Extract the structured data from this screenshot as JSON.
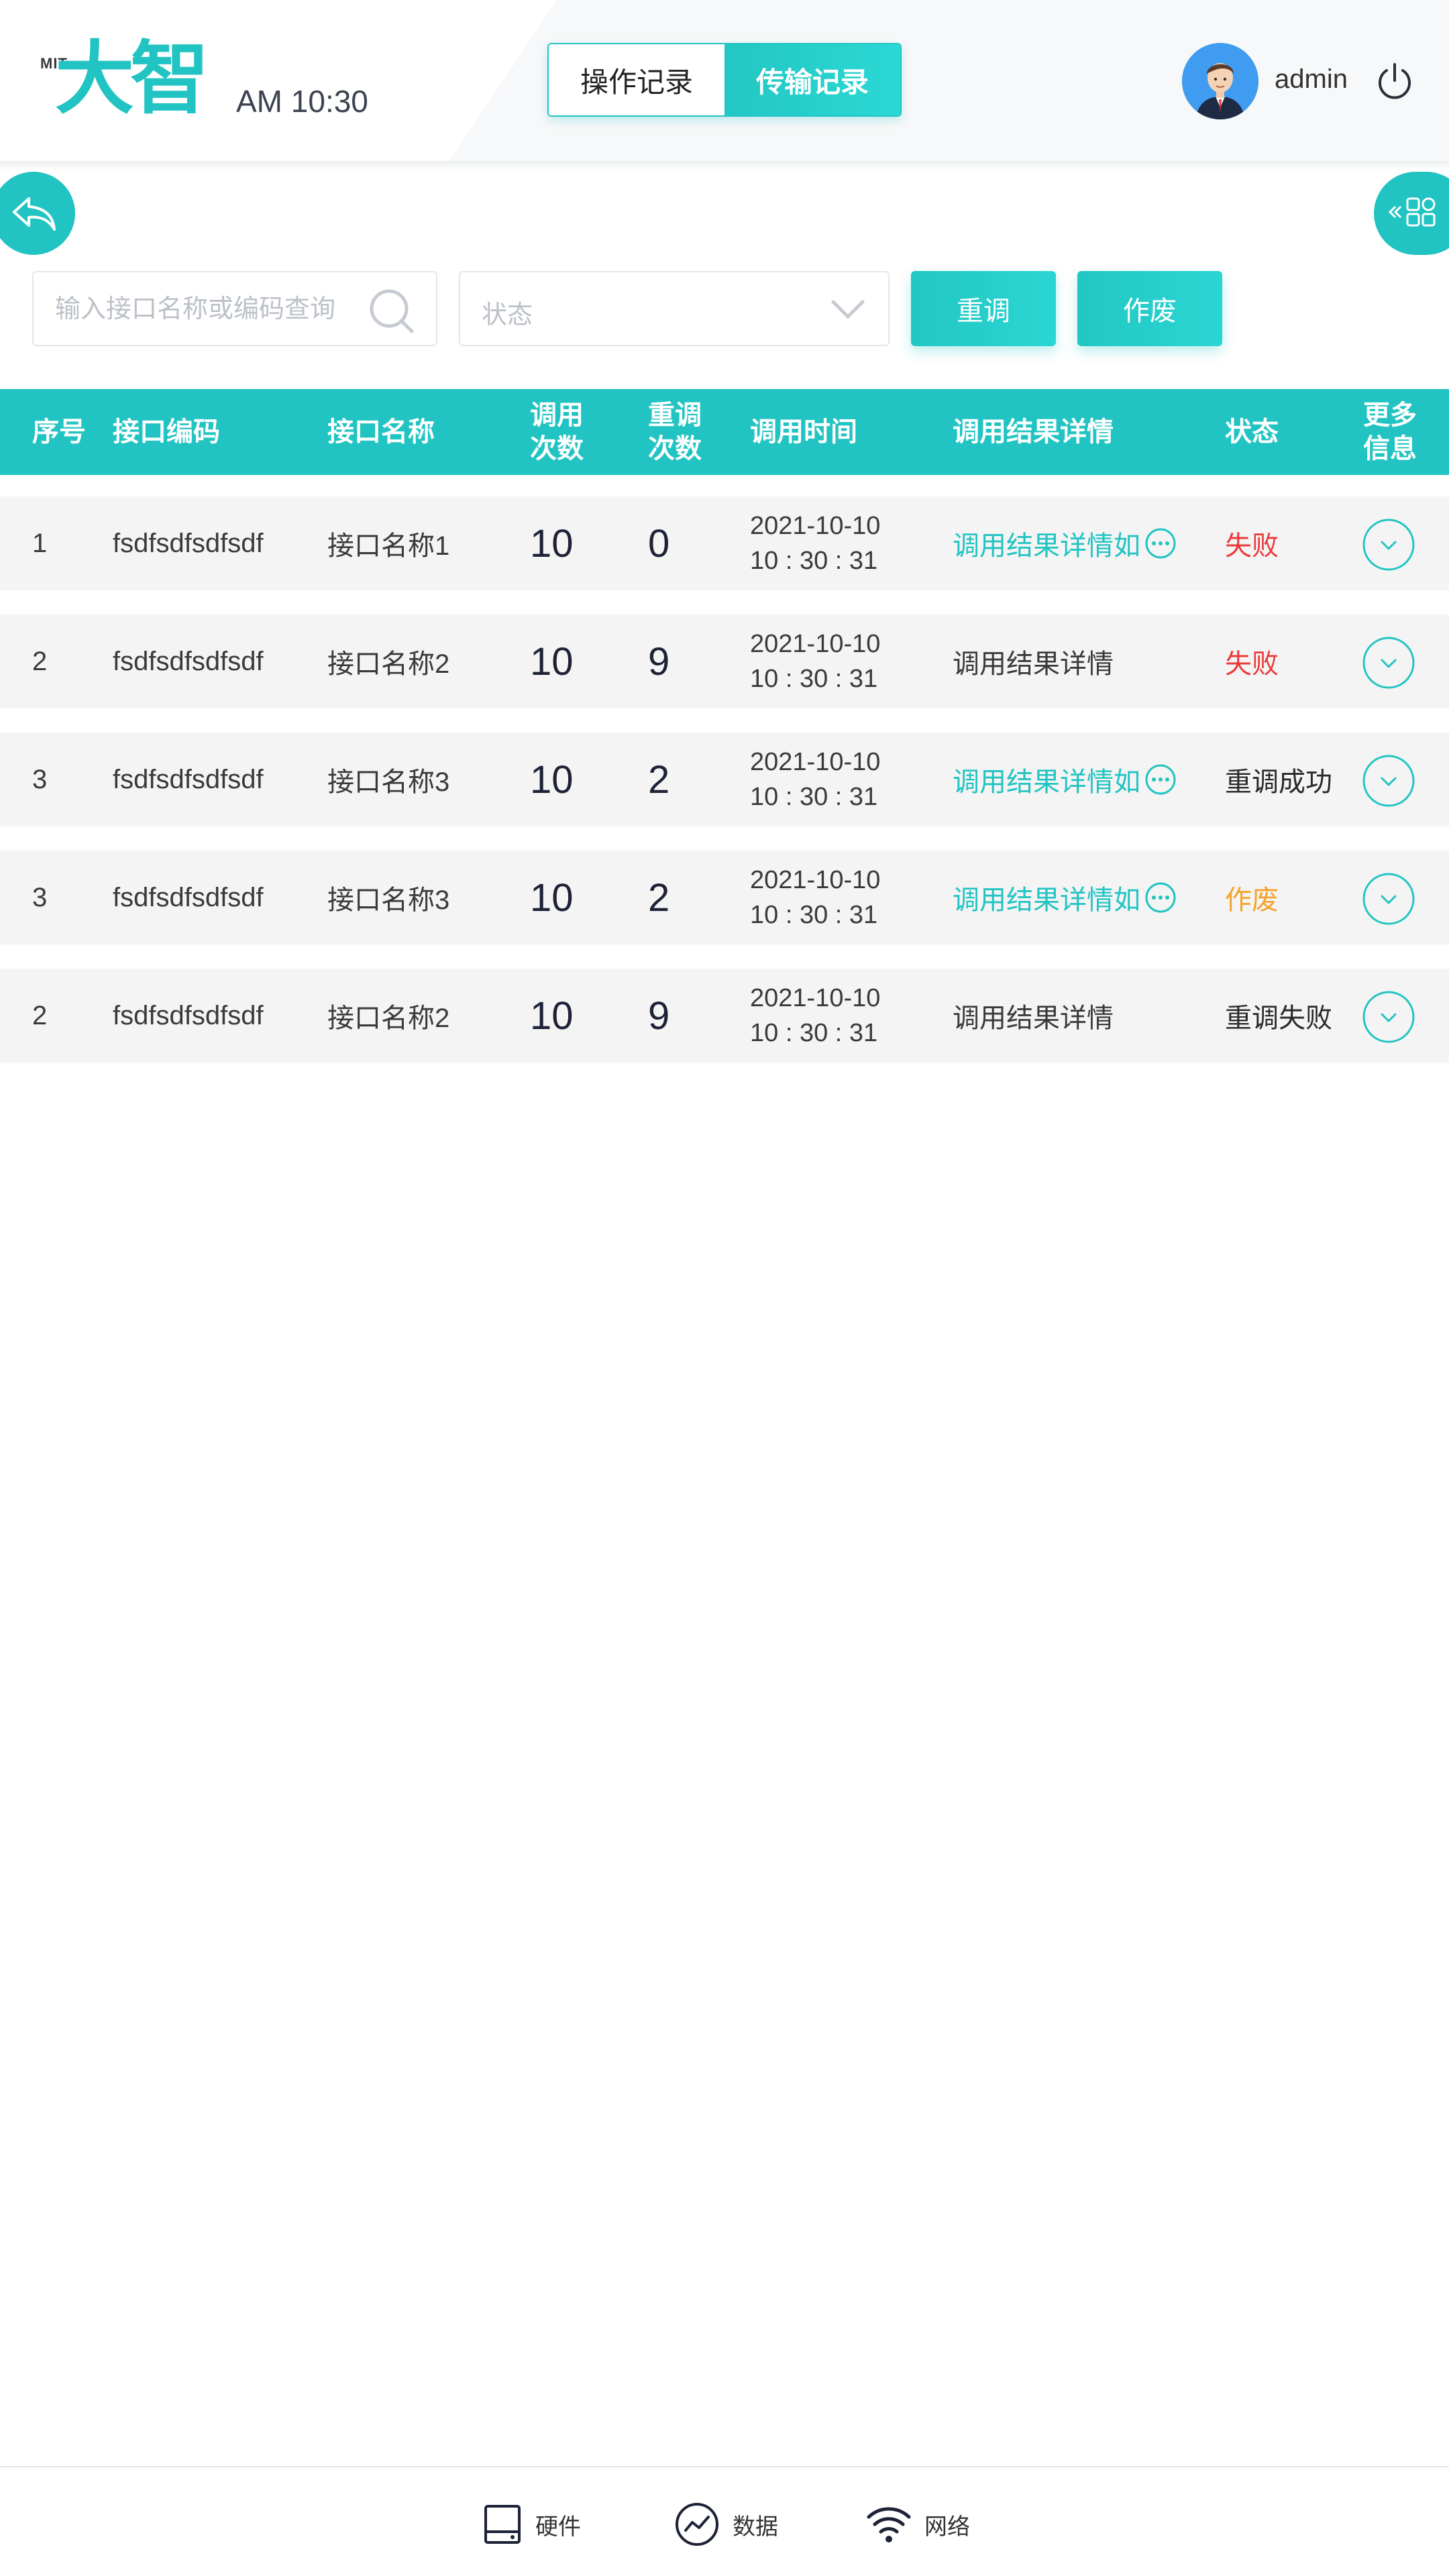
{
  "header": {
    "logo_small": "MIT",
    "logo_text": "大智",
    "time": "AM 10:30",
    "tabs": [
      {
        "label": "操作记录",
        "active": false
      },
      {
        "label": "传输记录",
        "active": true
      }
    ],
    "user": "admin"
  },
  "filters": {
    "search_placeholder": "输入接口名称或编码查询",
    "status_placeholder": "状态",
    "retry_label": "重调",
    "void_label": "作废"
  },
  "table": {
    "headers": {
      "index": "序号",
      "code": "接口编码",
      "name": "接口名称",
      "calls_1": "调用",
      "calls_2": "次数",
      "retries_1": "重调",
      "retries_2": "次数",
      "time": "调用时间",
      "detail": "调用结果详情",
      "status": "状态",
      "more_1": "更多",
      "more_2": "信息"
    },
    "rows": [
      {
        "index": "1",
        "code": "fsdfsdfsdfsdf",
        "name": "接口名称1",
        "calls": "10",
        "retries": "0",
        "date": "2021-10-10",
        "time": "10 : 30 : 31",
        "detail": "调用结果详情如",
        "detail_link": true,
        "status": "失败",
        "status_type": "fail"
      },
      {
        "index": "2",
        "code": "fsdfsdfsdfsdf",
        "name": "接口名称2",
        "calls": "10",
        "retries": "9",
        "date": "2021-10-10",
        "time": "10 : 30 : 31",
        "detail": "调用结果详情",
        "detail_link": false,
        "status": "失败",
        "status_type": "fail"
      },
      {
        "index": "3",
        "code": "fsdfsdfsdfsdf",
        "name": "接口名称3",
        "calls": "10",
        "retries": "2",
        "date": "2021-10-10",
        "time": "10 : 30 : 31",
        "detail": "调用结果详情如",
        "detail_link": true,
        "status": "重调成功",
        "status_type": "normal"
      },
      {
        "index": "3",
        "code": "fsdfsdfsdfsdf",
        "name": "接口名称3",
        "calls": "10",
        "retries": "2",
        "date": "2021-10-10",
        "time": "10 : 30 : 31",
        "detail": "调用结果详情如",
        "detail_link": true,
        "status": "作废",
        "status_type": "void"
      },
      {
        "index": "2",
        "code": "fsdfsdfsdfsdf",
        "name": "接口名称2",
        "calls": "10",
        "retries": "9",
        "date": "2021-10-10",
        "time": "10 : 30 : 31",
        "detail": "调用结果详情",
        "detail_link": false,
        "status": "重调失败",
        "status_type": "normal"
      }
    ]
  },
  "bottom_nav": [
    {
      "label": "硬件",
      "icon": "hardware-icon"
    },
    {
      "label": "数据",
      "icon": "data-icon"
    },
    {
      "label": "网络",
      "icon": "wifi-icon"
    }
  ],
  "colors": {
    "accent": "#21c4c2",
    "fail": "#ec3a3a",
    "void": "#f5a32a"
  }
}
